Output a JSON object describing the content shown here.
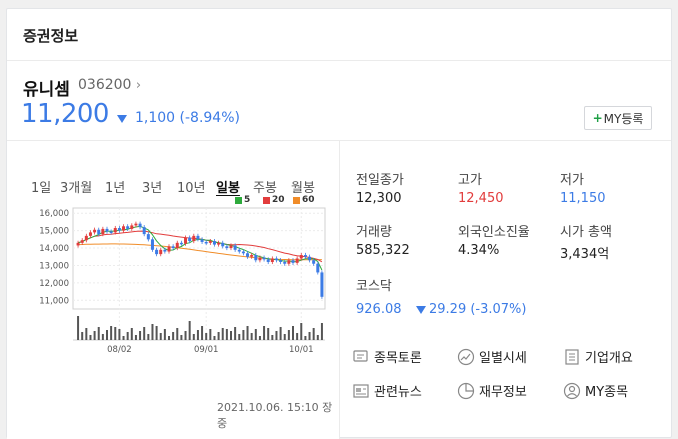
{
  "card": {
    "title": "증권정보"
  },
  "stock": {
    "name": "유니셈",
    "code": "036200",
    "code_chevron": "›",
    "price": "11,200",
    "change": "1,100 (-8.94%)",
    "direction": "down",
    "my_button": {
      "plus": "+",
      "label": "MY등록"
    }
  },
  "period_tabs": [
    {
      "label": "1일",
      "active": false
    },
    {
      "label": "3개월",
      "active": false
    },
    {
      "label": "1년",
      "active": false
    },
    {
      "label": "3년",
      "active": false
    },
    {
      "label": "10년",
      "active": false
    },
    {
      "label": "일봉",
      "active": true
    },
    {
      "label": "주봉",
      "active": false
    },
    {
      "label": "월봉",
      "active": false
    }
  ],
  "legend": [
    {
      "label": "5",
      "color": "#2eaa3c"
    },
    {
      "label": "20",
      "color": "#e23c3c"
    },
    {
      "label": "60",
      "color": "#f08c28"
    }
  ],
  "colors": {
    "up": "#e23c3c",
    "down": "#3c7be5",
    "accent": "#3c7be5"
  },
  "chart_data": {
    "type": "candlestick",
    "y_ticks": [
      "16,000",
      "15,000",
      "14,000",
      "13,000",
      "12,000",
      "11,000"
    ],
    "ylim": [
      10500,
      16300
    ],
    "x_ticks": [
      {
        "label": "08/02",
        "index": 10
      },
      {
        "label": "09/01",
        "index": 31
      },
      {
        "label": "10/01",
        "index": 54
      }
    ],
    "closes": [
      14300,
      14450,
      14700,
      14900,
      15050,
      14800,
      15100,
      14950,
      14900,
      15150,
      15000,
      15250,
      15100,
      15300,
      15400,
      15200,
      14800,
      14500,
      13900,
      13650,
      13900,
      13800,
      14100,
      14000,
      14300,
      14250,
      14600,
      14400,
      14700,
      14500,
      14350,
      14300,
      14400,
      14200,
      14300,
      14100,
      14000,
      14150,
      13900,
      13800,
      13700,
      13500,
      13600,
      13300,
      13450,
      13350,
      13200,
      13400,
      13300,
      13200,
      13100,
      13300,
      13150,
      13400,
      13600,
      13500,
      13300,
      13100,
      12600,
      11200
    ]
  },
  "timestamp": "2021.10.06. 15:10 장중",
  "stats": {
    "prev_close": {
      "label": "전일종가",
      "value": "12,300"
    },
    "high": {
      "label": "고가",
      "value": "12,450"
    },
    "low": {
      "label": "저가",
      "value": "11,150"
    },
    "volume": {
      "label": "거래량",
      "value": "585,322"
    },
    "foreign_rate": {
      "label": "외국인소진율",
      "value": "4.34%"
    },
    "market_cap": {
      "label": "시가 총액",
      "value": "3,434억"
    }
  },
  "index": {
    "label": "코스닥",
    "value": "926.08",
    "change": "29.29 (-3.07%)"
  },
  "links": [
    {
      "label": "종목토론",
      "icon": "chat-icon"
    },
    {
      "label": "일별시세",
      "icon": "trend-icon"
    },
    {
      "label": "기업개요",
      "icon": "list-icon"
    },
    {
      "label": "관련뉴스",
      "icon": "news-icon"
    },
    {
      "label": "재무정보",
      "icon": "piechart-icon"
    },
    {
      "label": "MY종목",
      "icon": "user-icon"
    }
  ]
}
